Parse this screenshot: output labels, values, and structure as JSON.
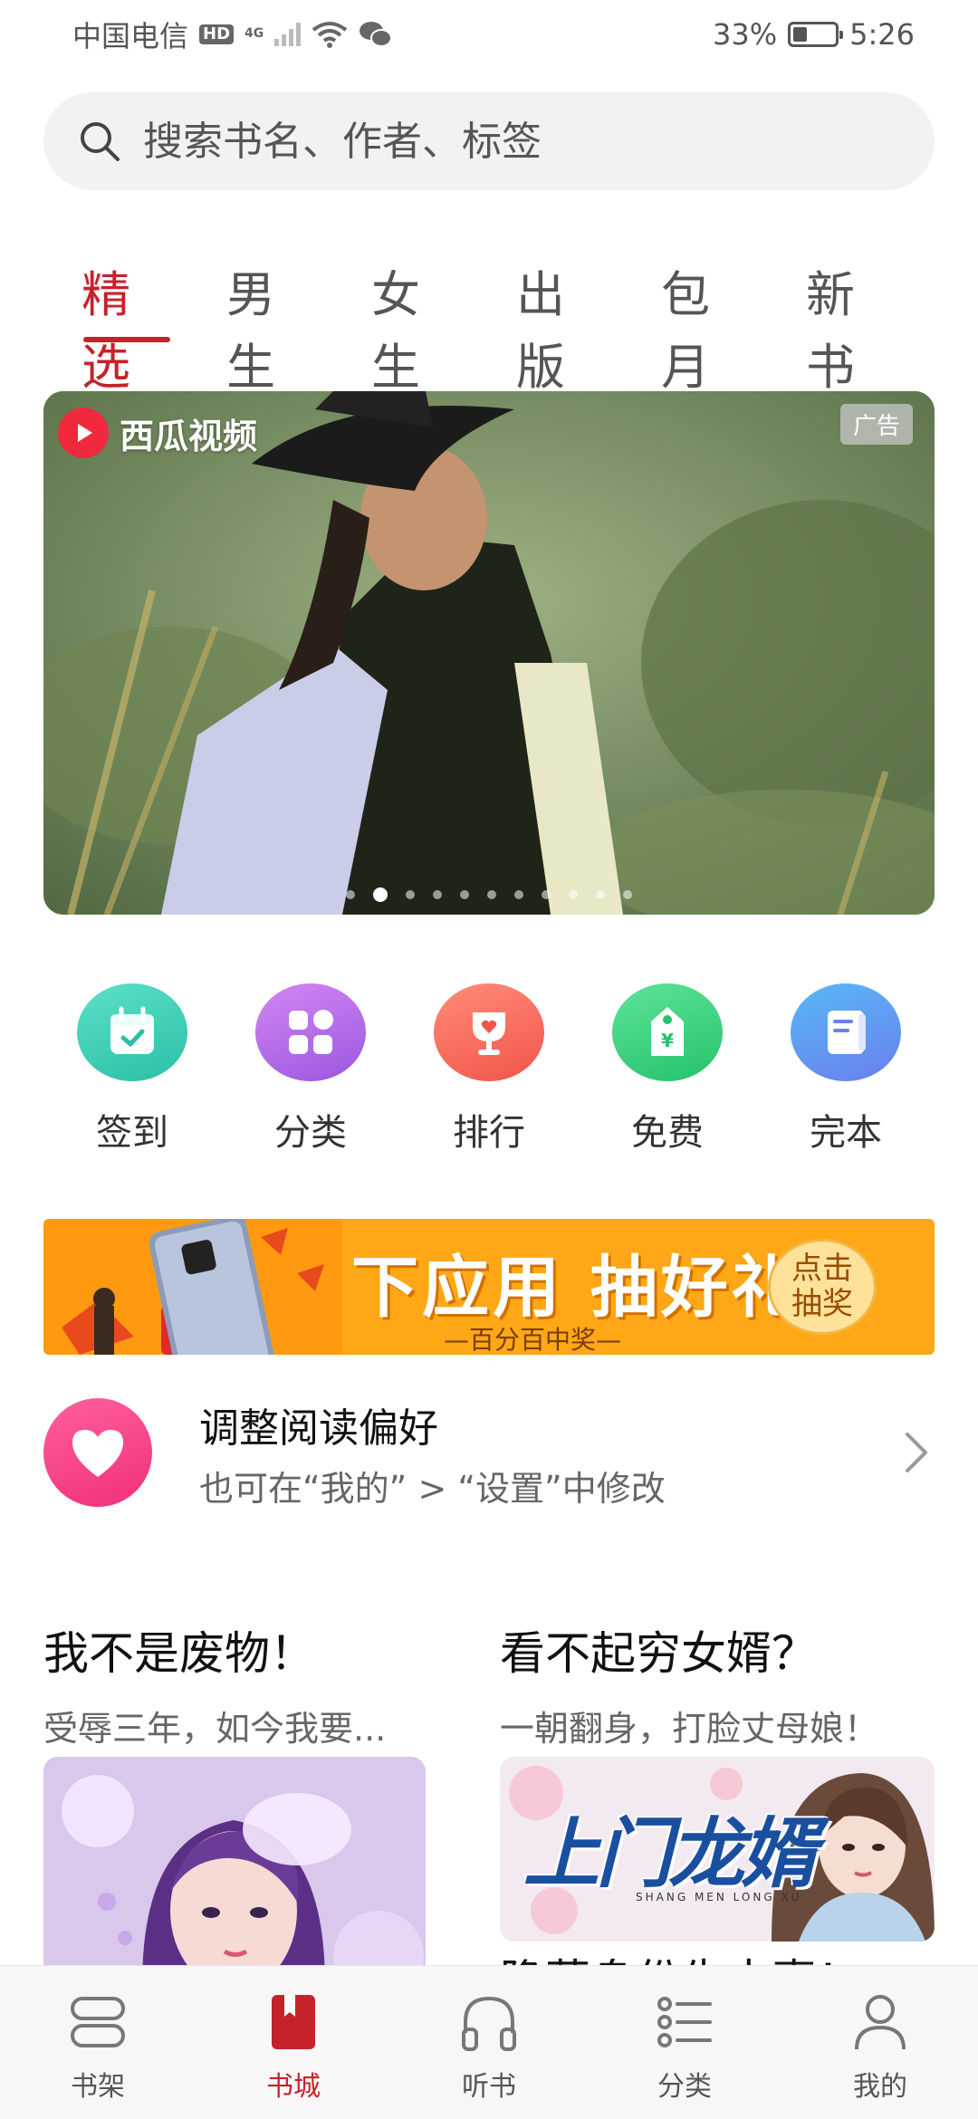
{
  "status_bar": {
    "carrier": "中国电信",
    "hd": "HD",
    "network": "4G",
    "battery_percent": "33%",
    "battery_level": 0.33,
    "time": "5:26"
  },
  "search": {
    "placeholder": "搜索书名、作者、标签"
  },
  "tabs": [
    {
      "label": "精选",
      "active": true
    },
    {
      "label": "男生",
      "active": false
    },
    {
      "label": "女生",
      "active": false
    },
    {
      "label": "出版",
      "active": false
    },
    {
      "label": "包月",
      "active": false
    },
    {
      "label": "新书",
      "active": false
    }
  ],
  "banner": {
    "logo_text": "西瓜视频",
    "ad_label": "广告",
    "slide_count": 11,
    "active_slide": 2
  },
  "quick_actions": [
    {
      "label": "签到",
      "icon": "calendar-check-icon",
      "color_from": "#5ce0c8",
      "color_to": "#2bbfa6"
    },
    {
      "label": "分类",
      "icon": "grid-icon",
      "color_from": "#d387f2",
      "color_to": "#9a56e0"
    },
    {
      "label": "排行",
      "icon": "trophy-icon",
      "color_from": "#ff8c77",
      "color_to": "#f2544c"
    },
    {
      "label": "免费",
      "icon": "price-tag-icon",
      "color_from": "#5fe39a",
      "color_to": "#24c26a"
    },
    {
      "label": "完本",
      "icon": "book-icon",
      "color_from": "#58b8f5",
      "color_to": "#6a7ff0"
    }
  ],
  "promo": {
    "title": "下应用 抽好礼",
    "subtitle": "—百分百中奖—",
    "button_line1": "点击",
    "button_line2": "抽奖"
  },
  "preference": {
    "title": "调整阅读偏好",
    "subtitle": "也可在“我的” > “设置”中修改"
  },
  "books": [
    {
      "title": "我不是废物！",
      "desc": "受辱三年，如今我要..."
    },
    {
      "title": "看不起穷女婿？",
      "desc": "一朝翻身，打脸丈母娘！",
      "cover_text": "上门龙婿",
      "cover_subtext": "SHANG MEN LONG XU"
    }
  ],
  "next_book_title": "隐藏身份先夫妻！",
  "bottom_nav": [
    {
      "label": "书架",
      "icon": "bookshelf-icon",
      "active": false
    },
    {
      "label": "书城",
      "icon": "bookstore-icon",
      "active": true
    },
    {
      "label": "听书",
      "icon": "headphones-icon",
      "active": false
    },
    {
      "label": "分类",
      "icon": "list-icon",
      "active": false
    },
    {
      "label": "我的",
      "icon": "profile-icon",
      "active": false
    }
  ],
  "colors": {
    "accent": "#c6222a",
    "promo": "#ffa716",
    "heart": "#f0307a"
  }
}
